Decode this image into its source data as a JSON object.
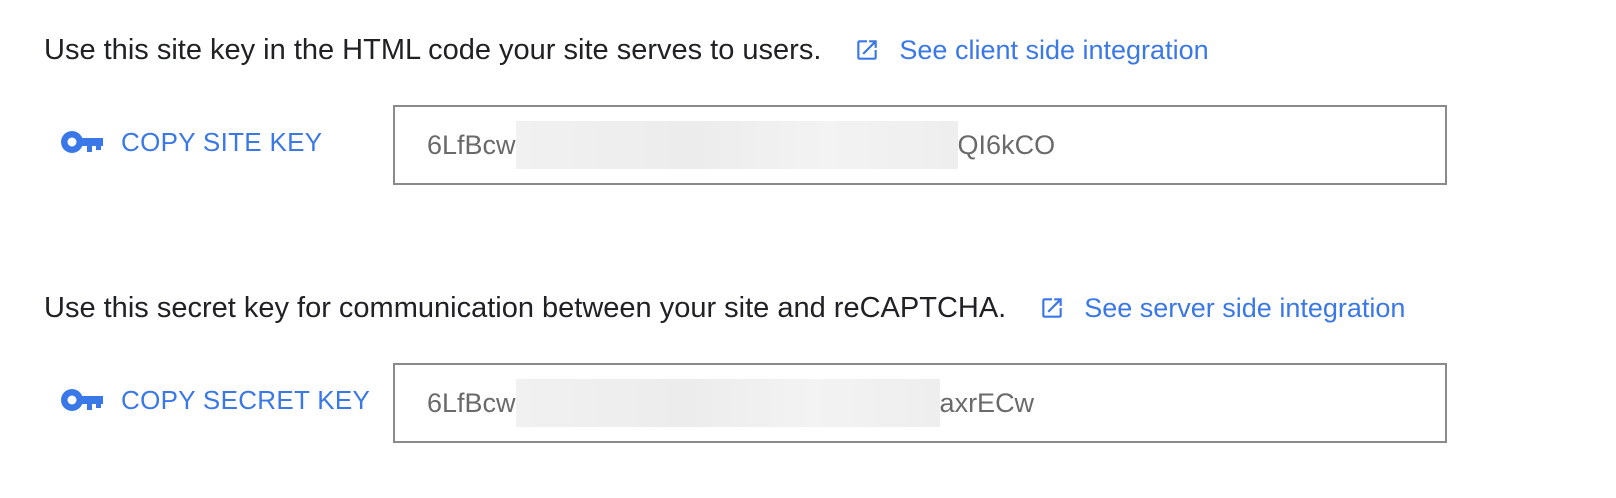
{
  "site_key": {
    "description": "Use this site key in the HTML code your site serves to users.",
    "link_label": "See client side integration",
    "copy_label": "COPY SITE KEY",
    "value_prefix": "6LfBcw",
    "value_suffix": "QI6kCO",
    "link_icon": "open-in-new-icon",
    "copy_icon": "key-icon"
  },
  "secret_key": {
    "description": "Use this secret key for communication between your site and reCAPTCHA.",
    "link_label": "See server side integration",
    "copy_label": "COPY SECRET KEY",
    "value_prefix": "6LfBcw",
    "value_suffix": "axrECw",
    "link_icon": "open-in-new-icon",
    "copy_icon": "key-icon"
  },
  "colors": {
    "accent": "#3b78e7",
    "text": "#202124",
    "key_text": "#6a6a6a",
    "border": "#8a8a8a"
  }
}
